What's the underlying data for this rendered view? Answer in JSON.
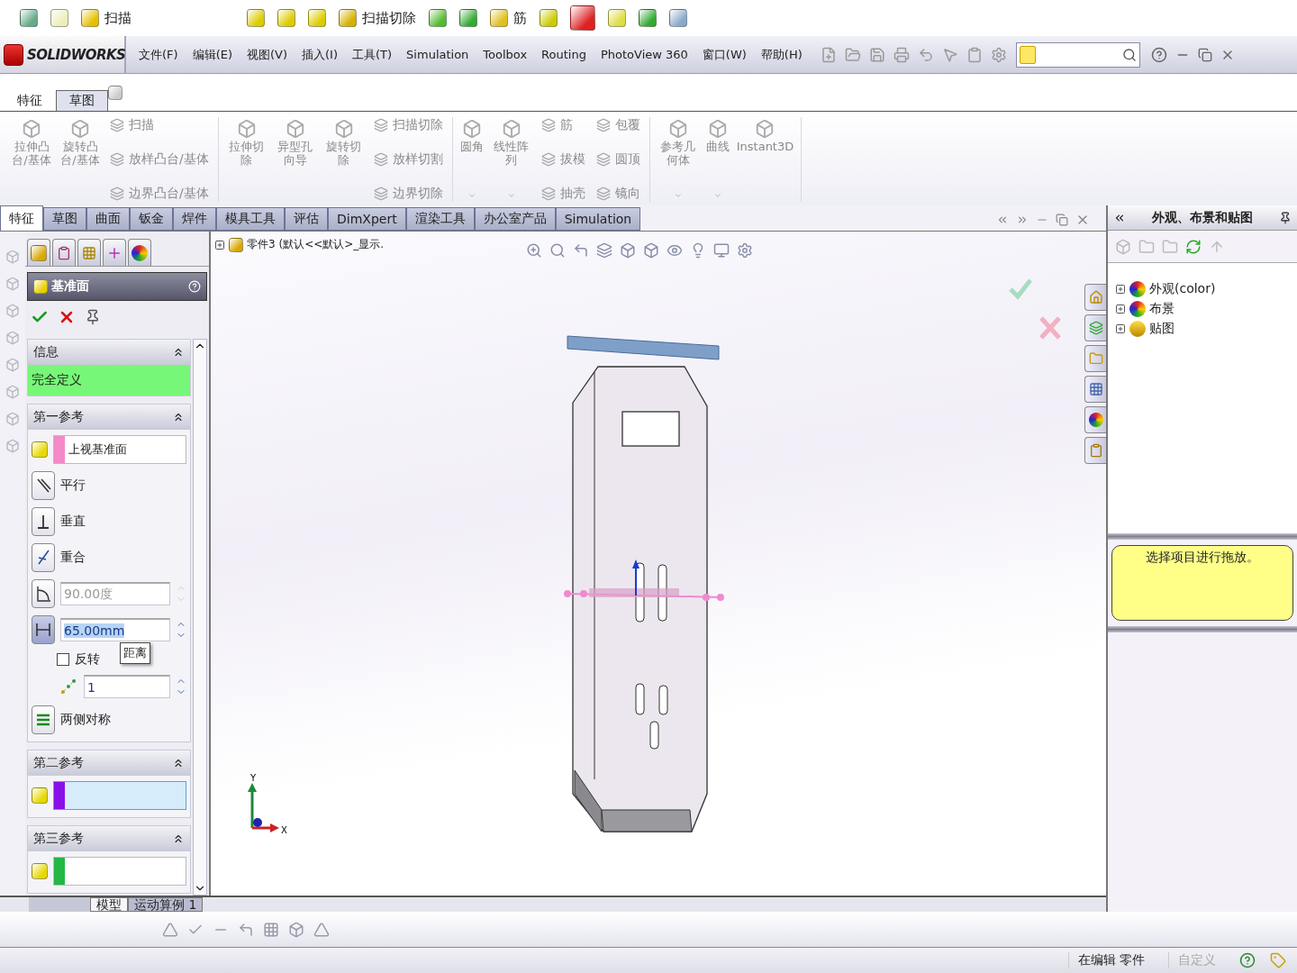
{
  "ghost_toolbar": {
    "items": [
      {
        "label": "扫描"
      },
      {
        "label": "扫描切除"
      },
      {
        "label": "筋"
      }
    ]
  },
  "menubar": {
    "logo": "SOLIDWORKS",
    "menus": [
      "文件(F)",
      "编辑(E)",
      "视图(V)",
      "插入(I)",
      "工具(T)",
      "Simulation",
      "Toolbox",
      "Routing",
      "PhotoView 360",
      "窗口(W)",
      "帮助(H)"
    ]
  },
  "ghost_tabs": [
    {
      "label": "特征",
      "selected": false
    },
    {
      "label": "草图",
      "selected": true
    }
  ],
  "ribbon": {
    "groups": [
      {
        "big": [
          {
            "label": "拉伸凸台/基体",
            "has_menu": false
          },
          {
            "label": "旋转凸台/基体",
            "has_menu": false
          }
        ],
        "columns": [
          [
            "扫描",
            "放样凸台/基体",
            "边界凸台/基体"
          ]
        ]
      },
      {
        "big": [
          {
            "label": "拉伸切除",
            "has_menu": false
          },
          {
            "label": "异型孔向导",
            "has_menu": false
          },
          {
            "label": "旋转切除",
            "has_menu": false
          }
        ],
        "columns": [
          [
            "扫描切除",
            "放样切割",
            "边界切除"
          ]
        ]
      },
      {
        "big": [
          {
            "label": "圆角",
            "has_menu": true
          },
          {
            "label": "线性阵列",
            "has_menu": true
          }
        ],
        "columns": [
          [
            "筋",
            "拔模",
            "抽壳"
          ],
          [
            "包覆",
            "圆顶",
            "镜向"
          ]
        ]
      },
      {
        "big": [
          {
            "label": "参考几何体",
            "has_menu": true
          },
          {
            "label": "曲线",
            "has_menu": true
          },
          {
            "label": "Instant3D",
            "has_menu": false
          }
        ]
      }
    ]
  },
  "command_tabs": [
    {
      "label": "特征",
      "selected": true
    },
    {
      "label": "草图",
      "selected": false
    },
    {
      "label": "曲面",
      "selected": false
    },
    {
      "label": "钣金",
      "selected": false
    },
    {
      "label": "焊件",
      "selected": false
    },
    {
      "label": "模具工具",
      "selected": false
    },
    {
      "label": "评估",
      "selected": false
    },
    {
      "label": "DimXpert",
      "selected": false
    },
    {
      "label": "渲染工具",
      "selected": false
    },
    {
      "label": "办公室产品",
      "selected": false
    },
    {
      "label": "Simulation",
      "selected": false
    }
  ],
  "property_manager": {
    "title": "基准面",
    "sections": [
      {
        "kind": "message",
        "title": "信息",
        "expanded": true,
        "text": "完全定义"
      },
      {
        "kind": "reference",
        "title": "第一参考",
        "expanded": true,
        "selection": "上视基准面",
        "color": "#f48ac8",
        "active": false,
        "options": [
          {
            "label": "平行",
            "selected": false
          },
          {
            "label": "垂直",
            "selected": false
          },
          {
            "label": "重合",
            "selected": false
          }
        ],
        "angle": {
          "value": "90.00度",
          "selected": false,
          "disabled": true
        },
        "distance": {
          "value": "65.00mm",
          "selected": true,
          "text_highlighted": true,
          "tooltip": "距离"
        },
        "flip": {
          "label": "反转",
          "checked": false
        },
        "count": {
          "value": "1"
        },
        "symmetric": {
          "label": "两侧对称",
          "selected": false
        }
      },
      {
        "kind": "reference",
        "title": "第二参考",
        "expanded": true,
        "color": "#8a10e8",
        "active": true
      },
      {
        "kind": "reference",
        "title": "第三参考",
        "expanded": true,
        "color": "#22b844",
        "active": false
      }
    ]
  },
  "document": {
    "breadcrumb": "零件3 (默认<<默认>_显示.",
    "triad": {
      "x": "X",
      "y": "Y"
    }
  },
  "bottom_tabs": [
    {
      "label": "模型",
      "selected": true
    },
    {
      "label": "运动算例 1",
      "selected": false
    }
  ],
  "task_pane": {
    "title": "外观、布景和贴图",
    "tree": [
      {
        "label": "外观(color)",
        "expanded": false
      },
      {
        "label": "布景",
        "expanded": false
      },
      {
        "label": "贴图",
        "expanded": false
      }
    ],
    "note": "选择项目进行拖放。"
  },
  "status_bar": [
    {
      "text": "在编辑 零件",
      "disabled": false
    },
    {
      "text": "自定义",
      "disabled": true
    }
  ]
}
